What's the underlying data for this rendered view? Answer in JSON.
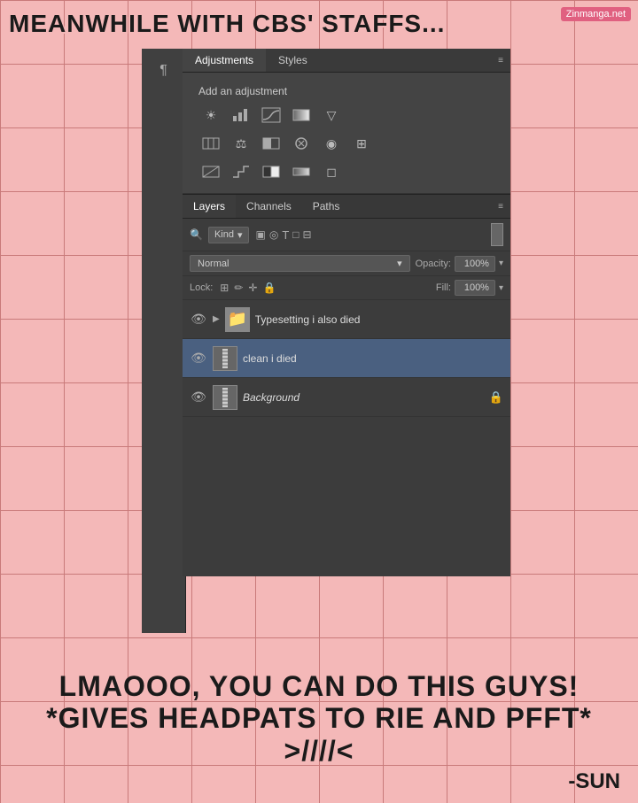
{
  "watermark": {
    "text": "Zinmanga.net"
  },
  "top_text": "MEANWHILE WITH CBS' STAFFS...",
  "bottom_text": "LMAOOO, YOU CAN DO THIS GUYS! *GIVES HEADPATS TO RIE AND PFFT* >////<",
  "signature": "-SUN",
  "adjustments_panel": {
    "tab1": "Adjustments",
    "tab2": "Styles",
    "title": "Add an adjustment",
    "icon_rows": [
      [
        "☀",
        "▦",
        "⊹",
        "◨",
        "▽"
      ],
      [
        "▭",
        "⚖",
        "◎",
        "⊞",
        "◉",
        "⊞"
      ],
      [
        "◑",
        "⟋",
        "▣",
        "⊟",
        "◻"
      ]
    ]
  },
  "layers_panel": {
    "tab1": "Layers",
    "tab2": "Channels",
    "tab3": "Paths",
    "kind_label": "Kind",
    "blend_mode": "Normal",
    "opacity_label": "Opacity:",
    "opacity_value": "100%",
    "lock_label": "Lock:",
    "fill_label": "Fill:",
    "fill_value": "100%",
    "layers": [
      {
        "name": "Typesetting i also died",
        "type": "group",
        "visible": true,
        "selected": false,
        "locked": false
      },
      {
        "name": "clean i died",
        "type": "layer",
        "visible": true,
        "selected": true,
        "locked": false
      },
      {
        "name": "Background",
        "type": "layer",
        "visible": true,
        "selected": false,
        "locked": true
      }
    ]
  }
}
